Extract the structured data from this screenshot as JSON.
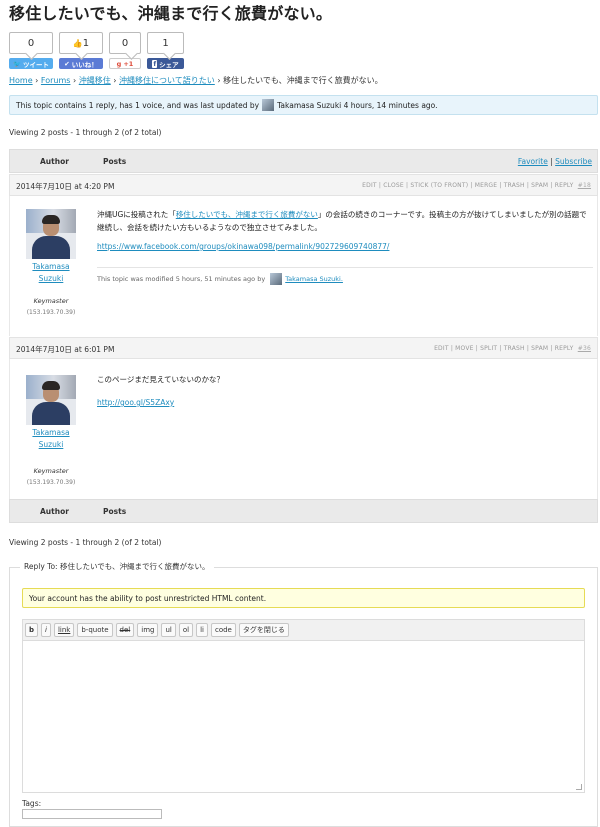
{
  "page": {
    "title": "移住したいでも、沖縄まで行く旅費がない。"
  },
  "share": {
    "tweet": {
      "count": "0",
      "label": "ツイート"
    },
    "like": {
      "count": "1",
      "label": "いいね！"
    },
    "gplus": {
      "count": "0",
      "label": "+1"
    },
    "fbshare": {
      "count": "1",
      "label": "シェア"
    }
  },
  "breadcrumb": {
    "items": [
      "Home",
      "Forums",
      "沖縄移住",
      "沖縄移住について語りたい"
    ],
    "separator": "›",
    "current": "移住したいでも、沖縄まで行く旅費がない。"
  },
  "topic_info": {
    "text": "This topic contains 1 reply, has 1 voice, and was last updated by",
    "user": "Takamasa Suzuki",
    "ago": "4 hours, 14 minutes ago."
  },
  "viewing": "Viewing 2 posts - 1 through 2 (of 2 total)",
  "table": {
    "author_col": "Author",
    "posts_col": "Posts",
    "favorite": "Favorite",
    "subscribe": "Subscribe",
    "sep": "|"
  },
  "posts": [
    {
      "date": "2014年7月10日 at 4:20 PM",
      "admin": "EDIT | CLOSE | STICK (TO FRONT) | MERGE | TRASH | SPAM | REPLY",
      "id": "#18",
      "author_first": "Takamasa",
      "author_last": "Suzuki",
      "role": "Keymaster",
      "ip": "(153.193.70.39)",
      "text_pre": "沖縄UGに投稿された「",
      "text_link": "移住したいでも、沖縄まで行く旅費がない",
      "text_post": "」の会話の続きのコーナーです。投稿主の方が抜けてしまいましたが別の話題で継続し、会話を続けたい方もいるようなので独立させてみました。",
      "url": "https://www.facebook.com/groups/okinawa098/permalink/902729609740877/",
      "modified_prefix": "This topic was modified 5 hours, 51 minutes ago by",
      "modified_user": "Takamasa Suzuki."
    },
    {
      "date": "2014年7月10日 at 6:01 PM",
      "admin": "EDIT | MOVE | SPLIT | TRASH | SPAM | REPLY",
      "id": "#36",
      "author_first": "Takamasa",
      "author_last": "Suzuki",
      "role": "Keymaster",
      "ip": "(153.193.70.39)",
      "text": "このページまだ見えていないのかな？",
      "url": "http://goo.gl/S5ZAxy"
    }
  ],
  "reply": {
    "legend": "Reply To: 移住したいでも、沖縄まで行く旅費がない。",
    "html_notice": "Your account has the ability to post unrestricted HTML content.",
    "buttons": [
      "b",
      "i",
      "link",
      "b-quote",
      "del",
      "img",
      "ul",
      "ol",
      "li",
      "code",
      "タグを閉じる"
    ],
    "tags_label": "Tags:"
  },
  "colors": {
    "link": "#1e8cbe",
    "twitter": "#55acee",
    "like": "#5b7bd5",
    "gplus": "#dd4b39",
    "facebook": "#3b5998"
  }
}
